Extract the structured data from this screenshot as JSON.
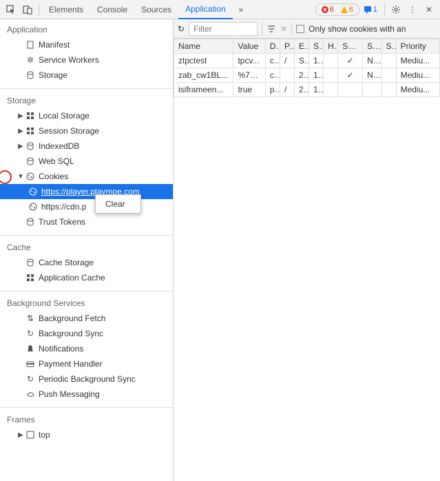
{
  "tabs": {
    "elements": "Elements",
    "console": "Console",
    "sources": "Sources",
    "application": "Application"
  },
  "badges": {
    "errors": "6",
    "warnings": "6",
    "messages": "1"
  },
  "sidebar": {
    "section_application": "Application",
    "manifest": "Manifest",
    "service_workers": "Service Workers",
    "storage": "Storage",
    "section_storage": "Storage",
    "local_storage": "Local Storage",
    "session_storage": "Session Storage",
    "indexeddb": "IndexedDB",
    "websql": "Web SQL",
    "cookies": "Cookies",
    "cookies_child_1": "https://player.plaympe.com",
    "cookies_child_2": "https://cdn.p",
    "trust_tokens": "Trust Tokens",
    "section_cache": "Cache",
    "cache_storage": "Cache Storage",
    "app_cache": "Application Cache",
    "section_bg": "Background Services",
    "bg_fetch": "Background Fetch",
    "bg_sync": "Background Sync",
    "notifications": "Notifications",
    "payment": "Payment Handler",
    "periodic_sync": "Periodic Background Sync",
    "push": "Push Messaging",
    "section_frames": "Frames",
    "top": "top"
  },
  "ctx": {
    "clear": "Clear"
  },
  "filter": {
    "placeholder": "Filter",
    "only_cookies": "Only show cookies with an"
  },
  "columns": {
    "name": "Name",
    "value": "Value",
    "d": "D..",
    "p": "P..",
    "e": "E..",
    "s": "S..",
    "h": "H..",
    "sec": "Sec..",
    "sa": "Sa..",
    "si": "S..",
    "pri": "Priority"
  },
  "rows": [
    {
      "name": "ztpctest",
      "value": "tpcv...",
      "d": "c...",
      "p": "/",
      "e": "S...",
      "s": "1...",
      "h": "",
      "sec": "✓",
      "sa": "N...",
      "si": "",
      "pri": "Mediu..."
    },
    {
      "name": "zab_cw1BL...",
      "value": "%7B...",
      "d": "c...",
      "p": "",
      "e": "2...",
      "s": "1...",
      "h": "",
      "sec": "✓",
      "sa": "N...",
      "si": "",
      "pri": "Mediu..."
    },
    {
      "name": "isiframeen...",
      "value": "true",
      "d": "p...",
      "p": "/",
      "e": "2...",
      "s": "1...",
      "h": "",
      "sec": "",
      "sa": "",
      "si": "",
      "pri": "Mediu..."
    }
  ]
}
